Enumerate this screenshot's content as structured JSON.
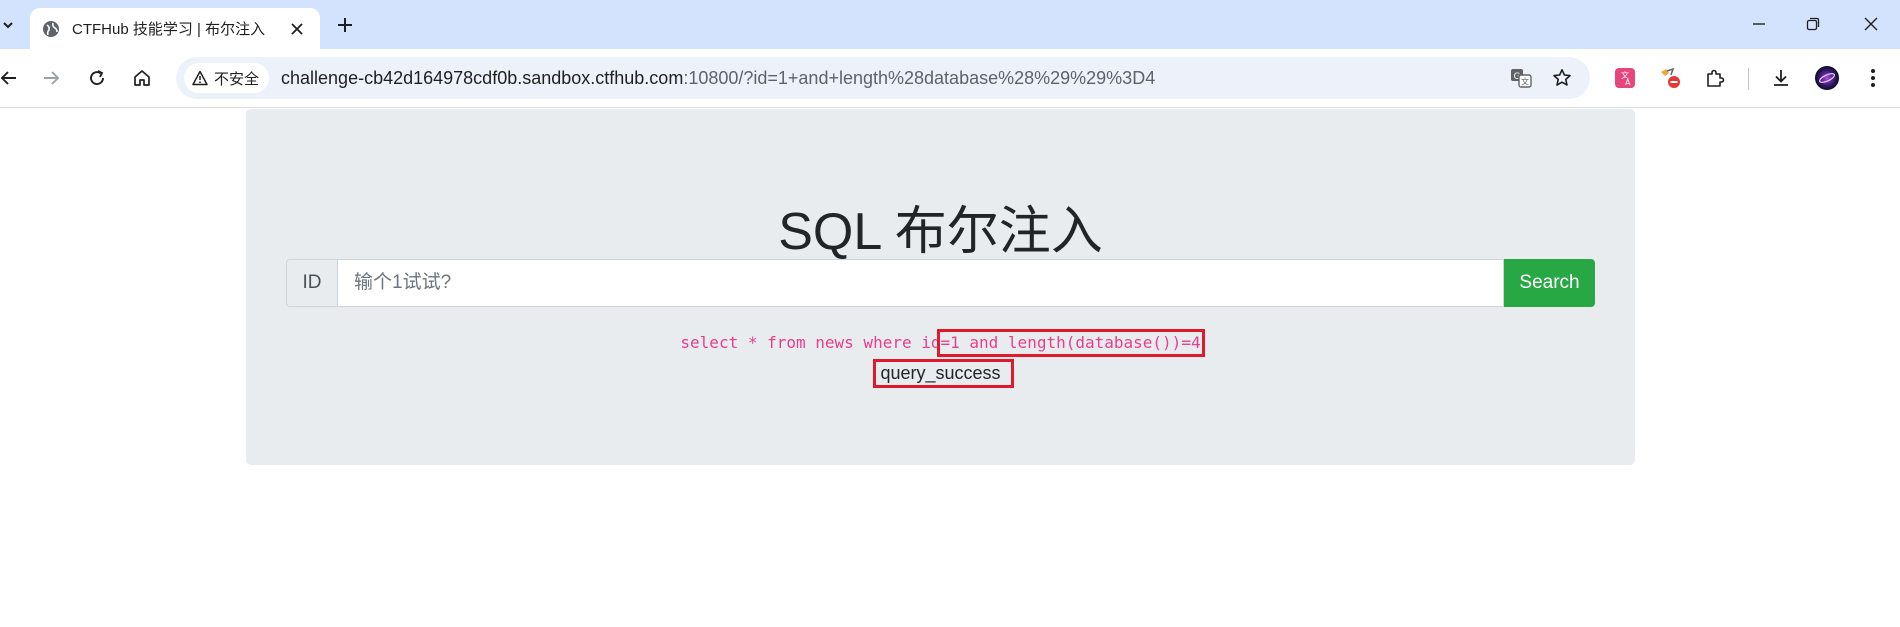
{
  "browser": {
    "tab": {
      "title": "CTFHub 技能学习 | 布尔注入"
    },
    "address_bar": {
      "security_label": "不安全",
      "url_host": "challenge-cb42d164978cdf0b.sandbox.ctfhub.com",
      "url_rest": ":10800/?id=1+and+length%28database%28%29%29%3D4"
    }
  },
  "page": {
    "title": "SQL 布尔注入",
    "search": {
      "prepend_label": "ID",
      "placeholder": "输个1试试?",
      "button_label": "Search"
    },
    "sql_query": "select * from news where id=1 and length(database())=4",
    "result": "query_success"
  },
  "colors": {
    "tabstrip": "#d3e3fd",
    "search_button": "#28a745",
    "sql_text": "#e83e8c",
    "highlight_box": "#e0192c"
  }
}
